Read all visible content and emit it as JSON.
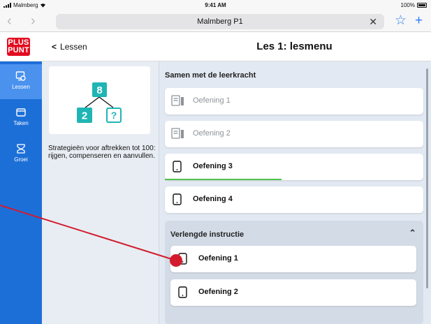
{
  "status_bar": {
    "carrier": "Malmberg",
    "time": "9:41 AM",
    "battery": "100%"
  },
  "browser": {
    "url_title": "Malmberg P1",
    "back_icon": "chevron-left-icon",
    "forward_icon": "chevron-right-icon",
    "close_icon": "close-icon",
    "bookmark_icon": "star-icon",
    "new_tab_icon": "plus-icon"
  },
  "logo": {
    "line1": "PLUS",
    "line2": "PUNT",
    "color": "#e30c1f"
  },
  "rail": {
    "color": "#1d6fd8",
    "active_color": "#4b92ee",
    "items": [
      {
        "label": "Lessen",
        "icon": "lessons-icon",
        "active": true
      },
      {
        "label": "Taken",
        "icon": "tasks-icon",
        "active": false
      },
      {
        "label": "Groei",
        "icon": "growth-icon",
        "active": false
      }
    ]
  },
  "header": {
    "back_label": "Lessen",
    "title": "Les 1: lesmenu"
  },
  "info": {
    "diagram": {
      "top": "8",
      "left": "2",
      "right": "?"
    },
    "diagram_color": "#1fb5b4",
    "description": "Strategieën voor aftrekken tot 100: rijgen, compenseren en aanvullen."
  },
  "lesson_list": {
    "section_title": "Samen met de leerkracht",
    "exercises": [
      {
        "label": "Oefening 1",
        "icon": "worksheet-icon",
        "state": "muted"
      },
      {
        "label": "Oefening 2",
        "icon": "worksheet-icon",
        "state": "muted"
      },
      {
        "label": "Oefening 3",
        "icon": "tablet-icon",
        "state": "active",
        "progress": 0.45
      },
      {
        "label": "Oefening 4",
        "icon": "tablet-icon",
        "state": "normal"
      }
    ],
    "group": {
      "title": "Verlengde instructie",
      "toggle_icon": "chevron-up-icon",
      "exercises": [
        {
          "label": "Oefening 1",
          "icon": "tablet-icon"
        },
        {
          "label": "Oefening 2",
          "icon": "tablet-icon"
        }
      ]
    },
    "progress_color": "#4fc14a"
  },
  "annotation": {
    "color": "#d21c2e"
  }
}
